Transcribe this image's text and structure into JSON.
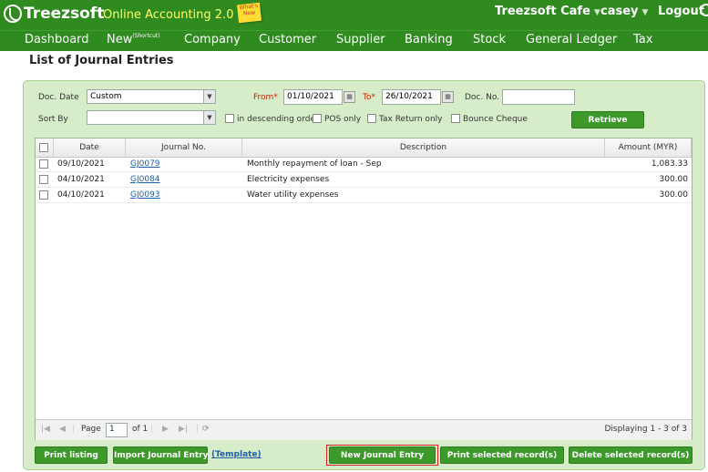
{
  "header": {
    "brand": "Treezsoft",
    "app_name": "Online Accounting 2.0",
    "sticky_note": "What's New",
    "company": "Treezsoft Cafe",
    "user": "casey",
    "logout": "Logout"
  },
  "nav": {
    "items": [
      "Dashboard",
      "New",
      "Company",
      "Customer",
      "Supplier",
      "Banking",
      "Stock",
      "General Ledger",
      "Tax"
    ],
    "new_sup": "(Shortcut)"
  },
  "page": {
    "title": "List of Journal Entries"
  },
  "filters": {
    "doc_date_label": "Doc. Date",
    "doc_date_value": "Custom",
    "from_label": "From",
    "from_value": "01/10/2021",
    "to_label": "To",
    "to_value": "26/10/2021",
    "doc_no_label": "Doc. No.",
    "doc_no_value": "",
    "sort_by_label": "Sort By",
    "sort_by_value": "",
    "descending_label": "in descending order",
    "pos_only_label": "POS only",
    "tax_return_label": "Tax Return only",
    "bounce_cheque_label": "Bounce Cheque",
    "retrieve_label": "Retrieve",
    "required_mark": "*"
  },
  "table": {
    "columns": [
      "Date",
      "Journal No.",
      "Description",
      "Amount (MYR)"
    ],
    "rows": [
      {
        "date": "09/10/2021",
        "journal_no": "GJ0079",
        "description": "Monthly repayment of loan - Sep",
        "amount": "1,083.33"
      },
      {
        "date": "04/10/2021",
        "journal_no": "GJ0084",
        "description": "Electricity expenses",
        "amount": "300.00"
      },
      {
        "date": "04/10/2021",
        "journal_no": "GJ0093",
        "description": "Water utility expenses",
        "amount": "300.00"
      }
    ]
  },
  "pager": {
    "page_label": "Page",
    "page_value": "1",
    "of_label": "of 1",
    "display_text": "Displaying 1 - 3 of 3"
  },
  "actions": {
    "print_listing": "Print listing",
    "import_journal": "Import Journal Entry",
    "template_link": "(Template)",
    "new_journal": "New Journal Entry",
    "print_selected": "Print selected record(s)",
    "delete_selected": "Delete selected record(s)"
  },
  "colors": {
    "brand_green": "#2f8b20",
    "panel_green": "#d7ecc8",
    "highlight_red": "#dd2222"
  }
}
